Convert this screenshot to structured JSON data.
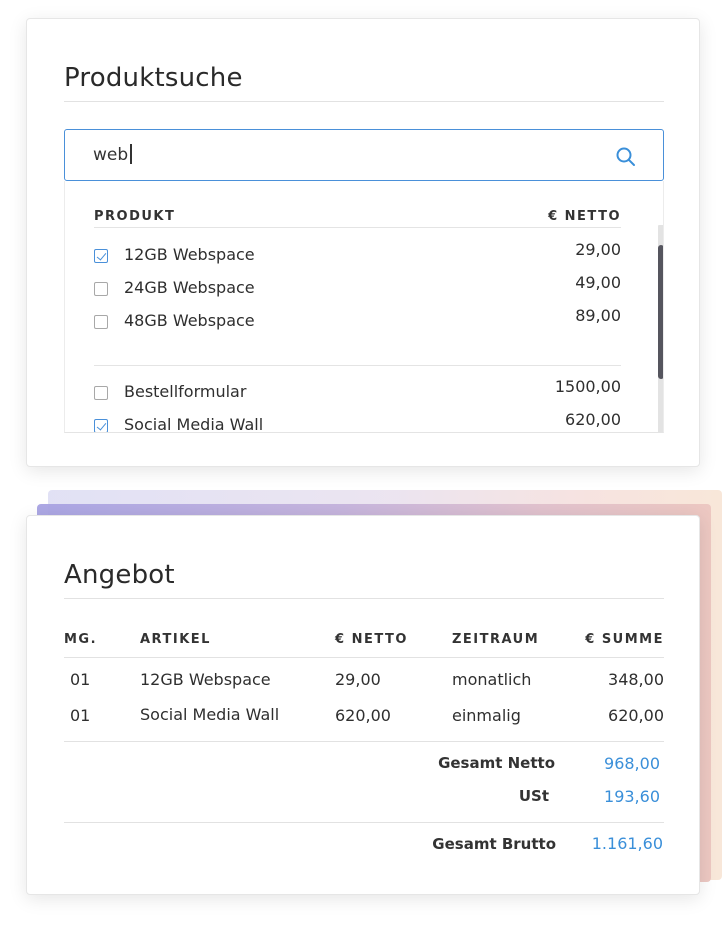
{
  "search": {
    "title": "Produktsuche",
    "query": "web",
    "header": {
      "product": "PRODUKT",
      "net": "€ NETTO"
    },
    "items": [
      {
        "label": "12GB Webspace",
        "price": "29,00",
        "checked": true
      },
      {
        "label": "24GB Webspace",
        "price": "49,00",
        "checked": false
      },
      {
        "label": "48GB Webspace",
        "price": "89,00",
        "checked": false
      },
      {
        "label": "Bestellformular",
        "price": "1500,00",
        "checked": false
      },
      {
        "label": "Social Media Wall",
        "price": "620,00",
        "checked": true
      }
    ]
  },
  "offer": {
    "title": "Angebot",
    "headers": {
      "qty": "MG.",
      "article": "ARTIKEL",
      "net": "€ NETTO",
      "period": "ZEITRAUM",
      "sum": "€ SUMME"
    },
    "rows": [
      {
        "qty": "01",
        "article": "12GB Webspace",
        "net": "29,00",
        "period": "monatlich",
        "sum": "348,00"
      },
      {
        "qty": "01",
        "article": "Social Media Wall",
        "net": "620,00",
        "period": "einmalig",
        "sum": "620,00"
      }
    ],
    "totals": {
      "net_label": "Gesamt Netto",
      "net_value": "968,00",
      "vat_label": "USt",
      "vat_value": "193,60",
      "gross_label": "Gesamt Brutto",
      "gross_value": "1.161,60"
    }
  },
  "colors": {
    "accent": "#3a8fd9",
    "focus_border": "#4a90d9",
    "scroll_thumb": "#55555e"
  },
  "icons": {
    "search": "search-icon",
    "checkbox_checked": "checkbox-checked-icon",
    "checkbox_unchecked": "checkbox-unchecked-icon"
  }
}
